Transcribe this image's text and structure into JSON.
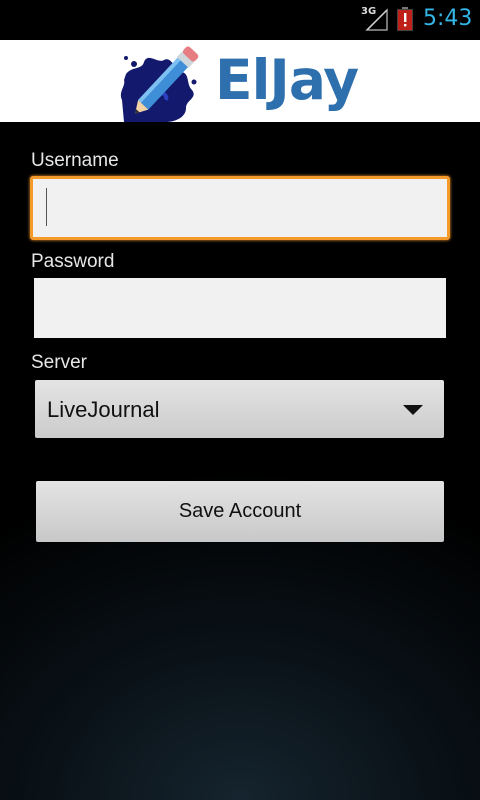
{
  "status_bar": {
    "network": "3G",
    "time": "5:43",
    "icons": [
      "signal-icon",
      "battery-alert-icon"
    ]
  },
  "header": {
    "app_name": "ElJay",
    "logo_icon": "pencil-splash-icon",
    "brand_color": "#2e6fad"
  },
  "form": {
    "username": {
      "label": "Username",
      "value": ""
    },
    "password": {
      "label": "Password",
      "value": ""
    },
    "server": {
      "label": "Server",
      "selected": "LiveJournal"
    },
    "save_label": "Save Account"
  },
  "colors": {
    "focus": "#f39a2a",
    "clock": "#33b5e5"
  }
}
